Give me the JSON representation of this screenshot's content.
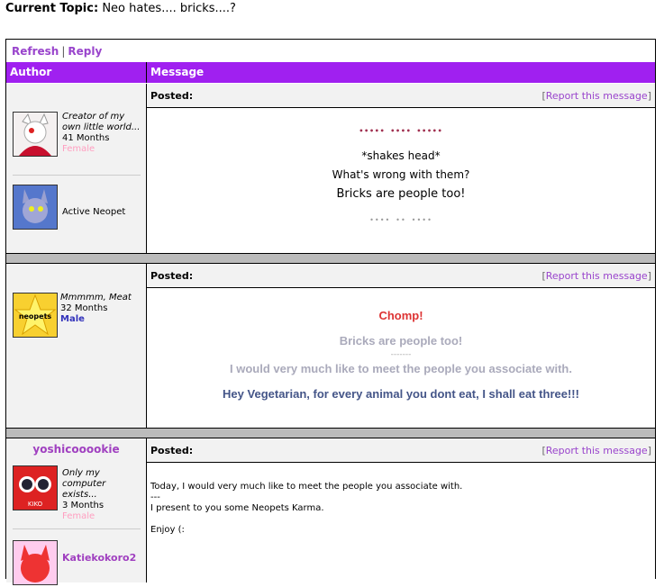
{
  "topic": {
    "label": "Current Topic:",
    "title": "Neo hates.... bricks....?"
  },
  "links": {
    "refresh": "Refresh",
    "sep": "|",
    "reply": "Reply"
  },
  "header": {
    "author": "Author",
    "message": "Message"
  },
  "posted_label": "Posted:",
  "report": {
    "open": "[",
    "link": "Report this message",
    "close": "]"
  },
  "posts": [
    {
      "authors": [
        {
          "title": "Creator of my own little world...",
          "months": "41 Months",
          "gender": "Female",
          "avatar": "white-red-neopet-avatar"
        },
        {
          "title": "Active Neopet",
          "avatar": "purple-wolf-neopet-avatar"
        }
      ],
      "message": {
        "header_sig": "••••• •••• •••••",
        "line1": "*shakes head*",
        "line2": "What's wrong with them?",
        "line3": "Bricks are people too!",
        "footer_sig": "•••• •• ••••"
      }
    },
    {
      "authors": [
        {
          "title": "Mmmmm, Meat",
          "months": "32 Months",
          "gender": "Male",
          "avatar": "neopets-star-logo-avatar"
        }
      ],
      "message": {
        "line1": "Chomp!",
        "line2": "Bricks are people too!",
        "divider": "-------",
        "line3": "I would very much like to meet the people you associate with.",
        "line4": "Hey Vegetarian, for every animal you dont eat, I shall eat three!!!"
      }
    },
    {
      "authors": [
        {
          "username": "yoshicooookie",
          "title": "Only my computer exists...",
          "months": "3 Months",
          "gender": "Female",
          "avatar": "red-kiko-avatar"
        },
        {
          "username": "Katiekokoro2",
          "avatar": "red-neopet-avatar"
        }
      ],
      "message": {
        "line1": "Today, I would very much like to meet the people you associate with.",
        "line2": "---",
        "line3": "I present to you some Neopets Karma.",
        "line4": "Enjoy (:"
      }
    }
  ],
  "colors": {
    "header_bg": "#a020f0",
    "link": "#9944cc",
    "female": "#ff9fc0",
    "male": "#3333bb",
    "chomp": "#dd3333",
    "grey_text": "#aaaabb",
    "blue_text": "#445588"
  }
}
